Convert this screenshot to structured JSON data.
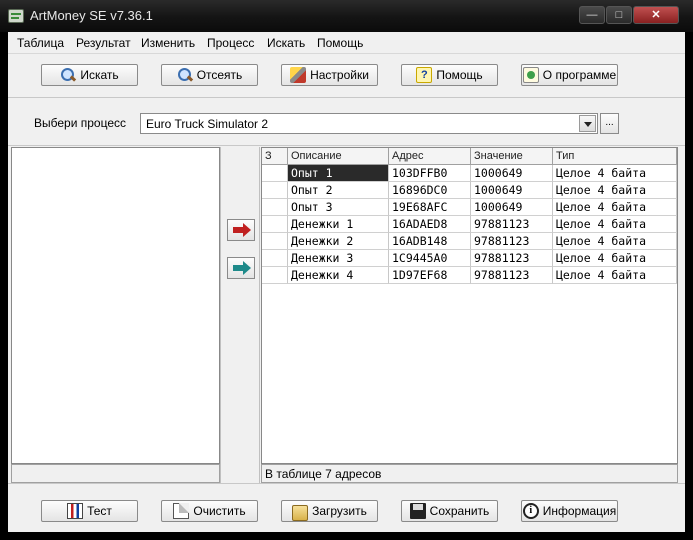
{
  "window": {
    "title": "ArtMoney SE v7.36.1",
    "min_glyph": "—",
    "max_glyph": "□",
    "close_glyph": "✕"
  },
  "menu": [
    "Таблица",
    "Результат",
    "Изменить",
    "Процесс",
    "Искать",
    "Помощь"
  ],
  "toolbar": {
    "search": "Искать",
    "filter": "Отсеять",
    "settings": "Настройки",
    "help": "Помощь",
    "about": "О программе",
    "help_glyph": "?"
  },
  "process": {
    "label": "Выбери процесс",
    "selected": "Euro Truck Simulator 2",
    "browse": "..."
  },
  "table": {
    "headers": [
      "З",
      "Описание",
      "Адрес",
      "Значение",
      "Тип"
    ],
    "rows": [
      {
        "frozen": "",
        "description": "Опыт 1",
        "address": "103DFFB0",
        "value": "1000649",
        "type": "Целое 4 байта"
      },
      {
        "frozen": "",
        "description": "Опыт 2",
        "address": "16896DC0",
        "value": "1000649",
        "type": "Целое 4 байта"
      },
      {
        "frozen": "",
        "description": "Опыт 3",
        "address": "19E68AFC",
        "value": "1000649",
        "type": "Целое 4 байта"
      },
      {
        "frozen": "",
        "description": "Денежки 1",
        "address": "16ADAED8",
        "value": "97881123",
        "type": "Целое 4 байта"
      },
      {
        "frozen": "",
        "description": "Денежки 2",
        "address": "16ADB148",
        "value": "97881123",
        "type": "Целое 4 байта"
      },
      {
        "frozen": "",
        "description": "Денежки 3",
        "address": "1C9445A0",
        "value": "97881123",
        "type": "Целое 4 байта"
      },
      {
        "frozen": "",
        "description": "Денежки 4",
        "address": "1D97EF68",
        "value": "97881123",
        "type": "Целое 4 байта"
      }
    ],
    "status": "В таблице 7 адресов"
  },
  "bottom": {
    "test": "Тест",
    "clear": "Очистить",
    "load": "Загрузить",
    "save": "Сохранить",
    "info": "Информация",
    "info_glyph": "i"
  }
}
